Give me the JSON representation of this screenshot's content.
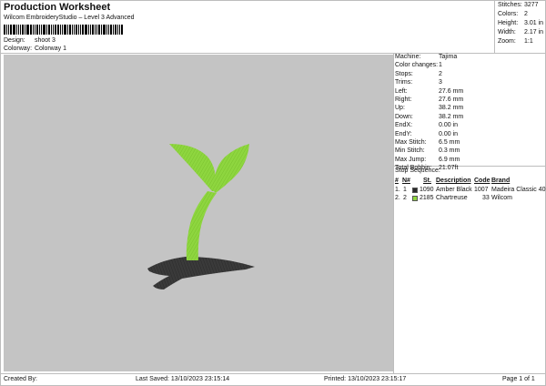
{
  "header": {
    "title": "Production Worksheet",
    "subtitle": "Wilcom EmbroideryStudio – Level 3 Advanced"
  },
  "design_info": {
    "design_label": "Design:",
    "design_value": "shoot 3",
    "colorway_label": "Colorway:",
    "colorway_value": "Colorway 1"
  },
  "summary": [
    {
      "label": "Stitches:",
      "value": "3277"
    },
    {
      "label": "Colors:",
      "value": "2"
    },
    {
      "label": "Height:",
      "value": "3.01 in"
    },
    {
      "label": "Width:",
      "value": "2.17 in"
    },
    {
      "label": "Zoom:",
      "value": "1:1"
    }
  ],
  "parameters": [
    {
      "label": "Machine:",
      "value": "Tajima"
    },
    {
      "label": "Color changes:",
      "value": "1"
    },
    {
      "label": "Stops:",
      "value": "2"
    },
    {
      "label": "Trims:",
      "value": "3"
    },
    {
      "label": "Left:",
      "value": "27.6 mm"
    },
    {
      "label": "Right:",
      "value": "27.6 mm"
    },
    {
      "label": "Up:",
      "value": "38.2 mm"
    },
    {
      "label": "Down:",
      "value": "38.2 mm"
    },
    {
      "label": "EndX:",
      "value": "0.00 in"
    },
    {
      "label": "EndY:",
      "value": "0.00 in"
    },
    {
      "label": "Max Stitch:",
      "value": "6.5 mm"
    },
    {
      "label": "Min Stitch:",
      "value": "0.3 mm"
    },
    {
      "label": "Max Jump:",
      "value": "6.9 mm"
    },
    {
      "label": "Total Bobbin:",
      "value": "21.07ft"
    }
  ],
  "stop_sequence": {
    "title": "Stop Sequence:",
    "headers": {
      "idx": "#",
      "n": "N#",
      "stitches": "St.",
      "description": "Description",
      "code": "Code",
      "brand": "Brand"
    },
    "rows": [
      {
        "idx": "1.",
        "n": "1",
        "color": "#2b2b2b",
        "stitches": "1090",
        "description": "Amber Black",
        "code": "1007",
        "brand": "Madeira Classic 40"
      },
      {
        "idx": "2.",
        "n": "2",
        "color": "#8ed63f",
        "stitches": "2185",
        "description": "Chartreuse",
        "code": "33",
        "brand": "Wilcom"
      }
    ]
  },
  "footer": {
    "created_by": "Created By:",
    "last_saved": "Last Saved: 13/10/2023 23:15:14",
    "printed": "Printed: 13/10/2023 23:15:17",
    "page": "Page 1 of 1"
  },
  "colors": {
    "canvas_bg": "#c4c4c4",
    "leaf_green": "#8ed63f",
    "soil_black": "#3a3a3a"
  },
  "icons": {
    "barcode": "barcode-icon"
  }
}
